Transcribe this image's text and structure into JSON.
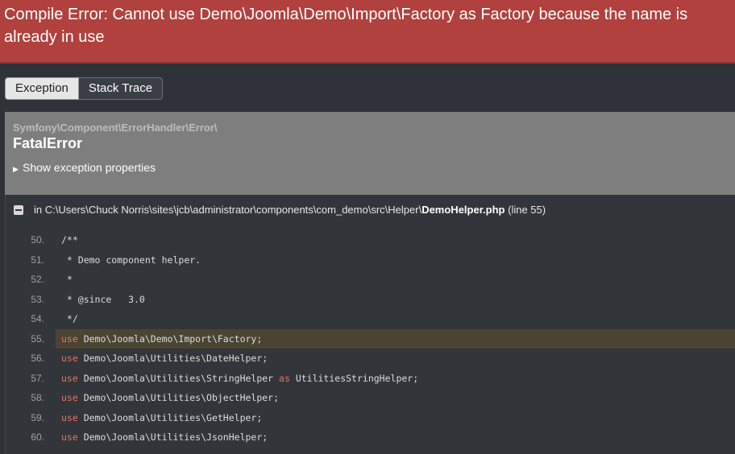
{
  "error": {
    "title": "Compile Error: Cannot use Demo\\Joomla\\Demo\\Import\\Factory as Factory because the name is already in use"
  },
  "tabs": [
    {
      "label": "Exception",
      "active": true
    },
    {
      "label": "Stack Trace",
      "active": false
    }
  ],
  "exception": {
    "namespace": "Symfony\\Component\\ErrorHandler\\Error\\",
    "class_name": "FatalError",
    "toggle_label": "Show exception properties"
  },
  "trace": {
    "prefix": "in",
    "path": "C:\\Users\\Chuck Norris\\sites\\jcb\\administrator\\components\\com_demo\\src\\Helper\\",
    "file": "DemoHelper.php",
    "line_info": "(line 55)"
  },
  "code": {
    "highlight_line": 55,
    "lines": [
      {
        "num": "50.",
        "kw": "",
        "text": "/**"
      },
      {
        "num": "51.",
        "kw": "",
        "text": " * Demo component helper."
      },
      {
        "num": "52.",
        "kw": "",
        "text": " *"
      },
      {
        "num": "53.",
        "kw": "",
        "text": " * @since   3.0"
      },
      {
        "num": "54.",
        "kw": "",
        "text": " */"
      },
      {
        "num": "55.",
        "kw": "use",
        "text": " Demo\\Joomla\\Demo\\Import\\Factory;"
      },
      {
        "num": "56.",
        "kw": "use",
        "text": " Demo\\Joomla\\Utilities\\DateHelper;"
      },
      {
        "num": "57.",
        "kw": "use",
        "text": " Demo\\Joomla\\Utilities\\StringHelper ",
        "kw2": "as",
        "text2": " UtilitiesStringHelper;"
      },
      {
        "num": "58.",
        "kw": "use",
        "text": " Demo\\Joomla\\Utilities\\ObjectHelper;"
      },
      {
        "num": "59.",
        "kw": "use",
        "text": " Demo\\Joomla\\Utilities\\GetHelper;"
      },
      {
        "num": "60.",
        "kw": "use",
        "text": " Demo\\Joomla\\Utilities\\JsonHelper;"
      }
    ]
  }
}
